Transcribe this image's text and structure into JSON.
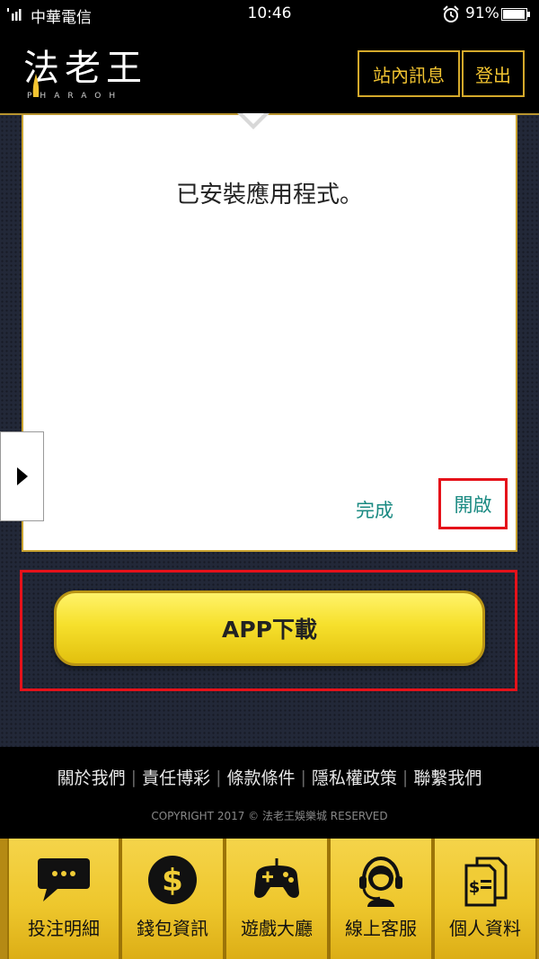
{
  "status_bar": {
    "carrier": "中華電信",
    "time": "10:46",
    "battery_percent": "91%"
  },
  "header": {
    "logo_text": "法老王",
    "logo_subtext": "PHARAOH",
    "messages_label": "站內訊息",
    "logout_label": "登出"
  },
  "dialog": {
    "message": "已安裝應用程式。",
    "done_label": "完成",
    "open_label": "開啟"
  },
  "main": {
    "download_label": "APP下載"
  },
  "footer": {
    "links": [
      "關於我們",
      "責任博彩",
      "條款條件",
      "隱私權政策",
      "聯繫我們"
    ],
    "copyright": "COPYRIGHT 2017 © 法老王娛樂城 RESERVED"
  },
  "bottom_nav": {
    "items": [
      {
        "label": "投注明細",
        "icon": "chat-bubble-icon"
      },
      {
        "label": "錢包資訊",
        "icon": "dollar-icon"
      },
      {
        "label": "遊戲大廳",
        "icon": "gamepad-icon"
      },
      {
        "label": "線上客服",
        "icon": "headset-agent-icon"
      },
      {
        "label": "個人資料",
        "icon": "documents-icon"
      }
    ]
  },
  "colors": {
    "gold_accent": "#d4a92b",
    "highlight_red": "#e5121a",
    "dialog_button_teal": "#1a8a82",
    "download_button_yellow": "#f6e02c"
  }
}
